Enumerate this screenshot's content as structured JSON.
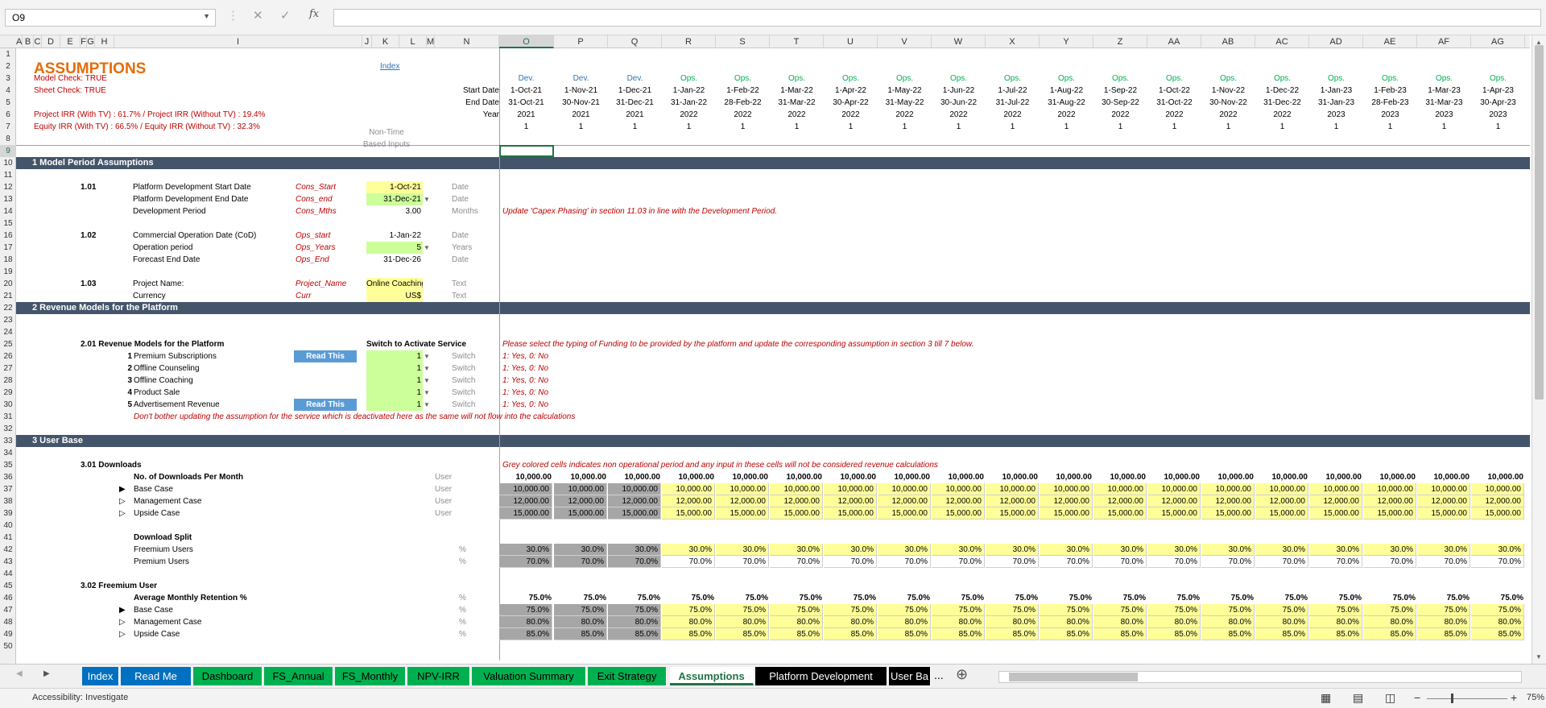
{
  "formula_bar": {
    "name_box": "O9",
    "fx": "fx",
    "value": ""
  },
  "columns": {
    "headers": [
      "A",
      "B",
      "C",
      "D",
      "E",
      "F",
      "G",
      "H",
      "I",
      "J",
      "K",
      "L",
      "M",
      "N",
      "O",
      "P",
      "Q",
      "R",
      "S",
      "T",
      "U",
      "V",
      "W",
      "X",
      "Y",
      "Z",
      "AA",
      "AB",
      "AC",
      "AD",
      "AE",
      "AF",
      "AG"
    ]
  },
  "rows": [
    "1",
    "2",
    "3",
    "4",
    "5",
    "6",
    "7",
    "8",
    "9",
    "10",
    "11",
    "12",
    "13",
    "14",
    "15",
    "16",
    "17",
    "18",
    "19",
    "20",
    "21",
    "22",
    "23",
    "24",
    "25",
    "26",
    "27",
    "28",
    "29",
    "30",
    "31",
    "32",
    "33",
    "34",
    "35",
    "36",
    "37",
    "38",
    "39",
    "40",
    "41",
    "42",
    "43",
    "44",
    "45",
    "46",
    "47",
    "48",
    "49",
    "50"
  ],
  "sheet": {
    "title": "ASSUMPTIONS",
    "index_link": "Index",
    "model_check": "Model Check: TRUE",
    "sheet_check": "Sheet Check: TRUE",
    "project_irr": "Project IRR (With TV) : 61.7% / Project IRR (Without TV) : 19.4%",
    "equity_irr": "Equity IRR (With TV) : 66.5% / Equity IRR (Without TV) : 32.3%",
    "labels": {
      "start": "Start Date",
      "end": "End Date",
      "year": "Year"
    },
    "non_time": "Non-Time",
    "based_inputs": "Based Inputs"
  },
  "timeline": {
    "phase": [
      "Dev.",
      "Dev.",
      "Dev.",
      "Ops.",
      "Ops.",
      "Ops.",
      "Ops.",
      "Ops.",
      "Ops.",
      "Ops.",
      "Ops.",
      "Ops.",
      "Ops.",
      "Ops.",
      "Ops.",
      "Ops.",
      "Ops.",
      "Ops.",
      "Ops."
    ],
    "start": [
      "1-Oct-21",
      "1-Nov-21",
      "1-Dec-21",
      "1-Jan-22",
      "1-Feb-22",
      "1-Mar-22",
      "1-Apr-22",
      "1-May-22",
      "1-Jun-22",
      "1-Jul-22",
      "1-Aug-22",
      "1-Sep-22",
      "1-Oct-22",
      "1-Nov-22",
      "1-Dec-22",
      "1-Jan-23",
      "1-Feb-23",
      "1-Mar-23",
      "1-Apr-23"
    ],
    "end": [
      "31-Oct-21",
      "30-Nov-21",
      "31-Dec-21",
      "31-Jan-22",
      "28-Feb-22",
      "31-Mar-22",
      "30-Apr-22",
      "31-May-22",
      "30-Jun-22",
      "31-Jul-22",
      "31-Aug-22",
      "30-Sep-22",
      "31-Oct-22",
      "30-Nov-22",
      "31-Dec-22",
      "31-Jan-23",
      "28-Feb-23",
      "31-Mar-23",
      "30-Apr-23"
    ],
    "year": [
      "2021",
      "2021",
      "2021",
      "2022",
      "2022",
      "2022",
      "2022",
      "2022",
      "2022",
      "2022",
      "2022",
      "2022",
      "2022",
      "2022",
      "2022",
      "2023",
      "2023",
      "2023",
      "2023"
    ],
    "flag": [
      "1",
      "1",
      "1",
      "1",
      "1",
      "1",
      "1",
      "1",
      "1",
      "1",
      "1",
      "1",
      "1",
      "1",
      "1",
      "1",
      "1",
      "1",
      "1"
    ]
  },
  "sections": {
    "s1": "1  Model Period Assumptions",
    "s2": "2  Revenue Models for the Platform",
    "s3": "3  User Base"
  },
  "s1": {
    "n101": "1.01",
    "n102": "1.02",
    "n103": "1.03",
    "rows": [
      {
        "label": "Platform Development Start Date",
        "name": "Cons_Start",
        "value": "1-Oct-21",
        "unit": "Date"
      },
      {
        "label": "Platform Development End Date",
        "name": "Cons_end",
        "value": "31-Dec-21",
        "unit": "Date"
      },
      {
        "label": "Development Period",
        "name": "Cons_Mths",
        "value": "3.00",
        "unit": "Months"
      },
      {
        "label": "Commercial Operation Date (CoD)",
        "name": "Ops_start",
        "value": "1-Jan-22",
        "unit": "Date"
      },
      {
        "label": "Operation period",
        "name": "Ops_Years",
        "value": "5",
        "unit": "Years"
      },
      {
        "label": "Forecast End Date",
        "name": "Ops_End",
        "value": "31-Dec-26",
        "unit": "Date"
      },
      {
        "label": "Project Name:",
        "name": "Project_Name",
        "value": "Online Coaching",
        "unit": "Text"
      },
      {
        "label": "Currency",
        "name": "Curr",
        "value": "US$",
        "unit": "Text"
      }
    ],
    "note": "Update 'Capex Phasing' in section 11.03 in line with the Development Period."
  },
  "s2": {
    "header": "2.01  Revenue Models for the Platform",
    "switch_header": "Switch to Activate Service",
    "note": "Please select the  typing of Funding to be provided by the platform and update the corresponding assumption in section 3 till 7 below.",
    "read_this": "Read This",
    "items": [
      {
        "n": "1",
        "label": "Premium Subscriptions",
        "value": "1",
        "unit": "Switch",
        "help": "1: Yes, 0: No"
      },
      {
        "n": "2",
        "label": "Offline Counseling",
        "value": "1",
        "unit": "Switch",
        "help": "1: Yes, 0: No"
      },
      {
        "n": "3",
        "label": "Offline Coaching",
        "value": "1",
        "unit": "Switch",
        "help": "1: Yes, 0: No"
      },
      {
        "n": "4",
        "label": "Product Sale",
        "value": "1",
        "unit": "Switch",
        "help": "1: Yes, 0: No"
      },
      {
        "n": "5",
        "label": "Advertisement Revenue",
        "value": "1",
        "unit": "Switch",
        "help": "1: Yes, 0: No"
      }
    ],
    "warning": "Don't bother updating the assumption for the service which is deactivated here as the same will not flow into the calculations"
  },
  "s3": {
    "h301": "3.01  Downloads",
    "grey_note": "Grey colored cells indicates non operational period and any input in these cells will not be considered revenue calculations",
    "downloads_label": "No. of Downloads Per Month",
    "downloads_value": "10,000.00",
    "cases": [
      {
        "marker": "▶",
        "label": "Base Case",
        "value": "10,000.00"
      },
      {
        "marker": "▷",
        "label": "Management Case",
        "value": "12,000.00"
      },
      {
        "marker": "▷",
        "label": "Upside Case",
        "value": "15,000.00"
      }
    ],
    "user": "User",
    "split_label": "Download Split",
    "split": [
      {
        "label": "Freemium Users",
        "value": "30.0%"
      },
      {
        "label": "Premium Users",
        "value": "70.0%"
      }
    ],
    "pct": "%",
    "h302": "3.02  Freemium User",
    "ret_label": "Average Monthly Retention %",
    "ret_value": "75.0%",
    "ret_cases": [
      {
        "marker": "▶",
        "label": "Base Case",
        "value": "75.0%"
      },
      {
        "marker": "▷",
        "label": "Management Case",
        "value": "80.0%"
      },
      {
        "marker": "▷",
        "label": "Upside Case",
        "value": "85.0%"
      }
    ]
  },
  "tabs": [
    {
      "label": "Index",
      "bg": "#0070c0",
      "fg": "#ffffff"
    },
    {
      "label": "Read Me",
      "bg": "#0070c0",
      "fg": "#ffffff"
    },
    {
      "label": "Dashboard",
      "bg": "#00b050",
      "fg": "#000000"
    },
    {
      "label": "FS_Annual",
      "bg": "#00b050",
      "fg": "#000000"
    },
    {
      "label": "FS_Monthly",
      "bg": "#00b050",
      "fg": "#000000"
    },
    {
      "label": "NPV-IRR",
      "bg": "#00b050",
      "fg": "#000000"
    },
    {
      "label": "Valuation Summary",
      "bg": "#00b050",
      "fg": "#000000"
    },
    {
      "label": "Exit Strategy",
      "bg": "#00b050",
      "fg": "#000000"
    },
    {
      "label": "Assumptions",
      "bg": "#ffffff",
      "fg": "#217346"
    },
    {
      "label": "Platform Development",
      "bg": "#000000",
      "fg": "#ffffff"
    },
    {
      "label": "User Ba",
      "bg": "#000000",
      "fg": "#ffffff"
    }
  ],
  "more_tabs": "...",
  "status": {
    "accessibility": "Accessibility: Investigate",
    "zoom": "75%"
  }
}
